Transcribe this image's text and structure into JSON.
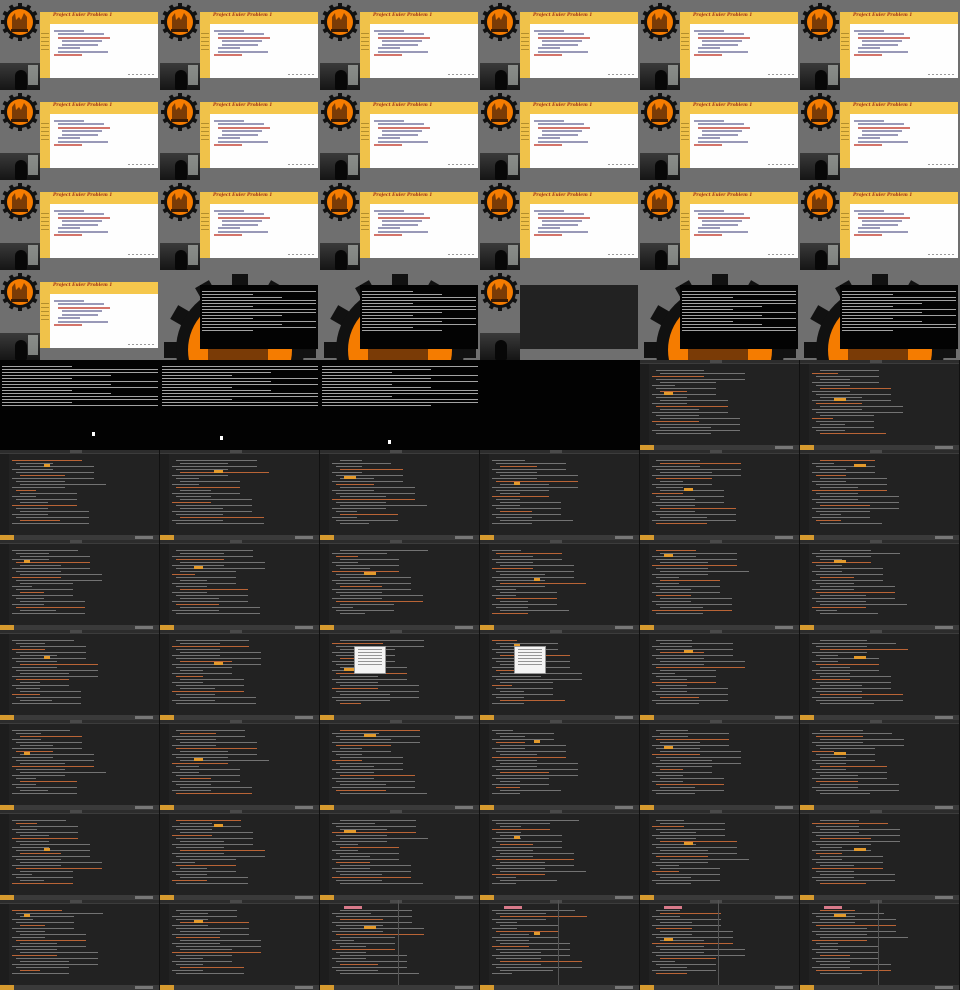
{
  "slide": {
    "title": "Project Euler Problem 1"
  },
  "grid": {
    "columns": 6,
    "rows": 11,
    "frames": [
      "slide",
      "slide",
      "slide",
      "slide",
      "slide",
      "slide",
      "slide",
      "slide",
      "slide",
      "slide",
      "slide",
      "slide",
      "slide",
      "slide",
      "slide",
      "slide",
      "slide",
      "slide",
      "slide",
      "terminal",
      "terminal",
      "editor-small",
      "terminal",
      "terminal",
      "terminal",
      "terminal",
      "terminal",
      "blank",
      "editor",
      "editor",
      "editor",
      "editor",
      "editor",
      "editor",
      "editor",
      "editor",
      "editor",
      "editor",
      "editor",
      "editor",
      "editor",
      "editor",
      "editor",
      "editor",
      "editor-popup",
      "editor-popup",
      "editor",
      "editor",
      "editor",
      "editor",
      "editor",
      "editor",
      "editor",
      "editor",
      "editor",
      "editor",
      "editor",
      "editor",
      "editor",
      "editor",
      "editor",
      "editor",
      "editor-split",
      "editor-split",
      "editor-split",
      "editor-split"
    ]
  },
  "colors": {
    "slide_header": "#f5c74c",
    "slide_title": "#a02f13",
    "logo_orange": "#f57c00",
    "editor_bg": "#222222",
    "highlight": "#e39a2c",
    "terminal_bg": "#020202"
  },
  "icons": {
    "logo": "orange-cog-logo-icon",
    "webcam": "webcam-overlay"
  }
}
